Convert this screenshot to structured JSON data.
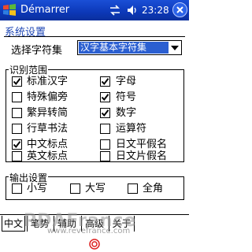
{
  "window": {
    "title": "Démarrer",
    "time": "23:28"
  },
  "page": {
    "heading": "系统设置"
  },
  "charset": {
    "label": "选择字符集",
    "value": "汉字基本字符集"
  },
  "recognition": {
    "title": "识别范围",
    "items": [
      {
        "label": "标准汉字",
        "checked": true
      },
      {
        "label": "字母",
        "checked": true
      },
      {
        "label": "特殊偏旁",
        "checked": false
      },
      {
        "label": "符号",
        "checked": true
      },
      {
        "label": "繁异转简",
        "checked": false
      },
      {
        "label": "数字",
        "checked": true
      },
      {
        "label": "行草书法",
        "checked": false
      },
      {
        "label": "运算符",
        "checked": false
      },
      {
        "label": "中文标点",
        "checked": true
      },
      {
        "label": "日文平假名",
        "checked": false
      },
      {
        "label": "英文标点",
        "checked": false
      },
      {
        "label": "日文片假名",
        "checked": false
      }
    ]
  },
  "output": {
    "title": "输出设置",
    "items": [
      {
        "label": "小写",
        "checked": false
      },
      {
        "label": "大写",
        "checked": false
      },
      {
        "label": "全角",
        "checked": false
      }
    ]
  },
  "tabs": [
    {
      "label": "中文",
      "active": true
    },
    {
      "label": "笔势"
    },
    {
      "label": "辅助"
    },
    {
      "label": "高级"
    },
    {
      "label": "关于"
    }
  ],
  "watermark": {
    "logo": "PDAFrance",
    "url": "www.revefrance.com"
  },
  "icons": {
    "start": "windows-flag-icon",
    "sync": "sync-arrows-icon",
    "volume": "speaker-icon",
    "close": "close-icon",
    "sip": "input-panel-icon"
  }
}
